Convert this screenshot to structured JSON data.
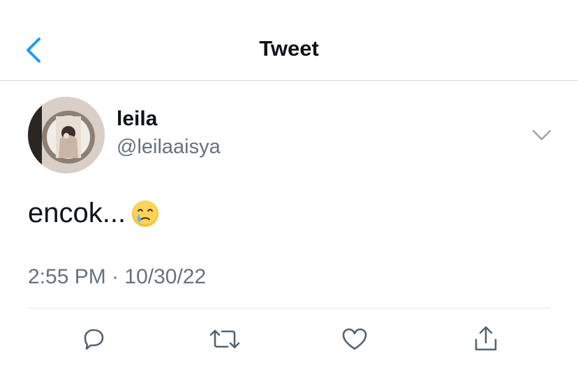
{
  "header": {
    "title": "Tweet",
    "back_icon": "chevron-left-icon",
    "accent": "#1d9bf0"
  },
  "tweet": {
    "display_name": "leila",
    "handle": "@leilaaisya",
    "text": "encok...",
    "emoji": "face-holding-back-tears-emoji",
    "timestamp": "2:55 PM · 10/30/22",
    "menu_icon": "chevron-down-icon"
  },
  "actions": [
    {
      "icon": "reply-icon"
    },
    {
      "icon": "retweet-icon"
    },
    {
      "icon": "like-icon"
    },
    {
      "icon": "share-icon"
    }
  ],
  "colors": {
    "text": "#0f1419",
    "secondary": "#66727c",
    "divider": "#e1e4e6",
    "icon": "#536471"
  }
}
